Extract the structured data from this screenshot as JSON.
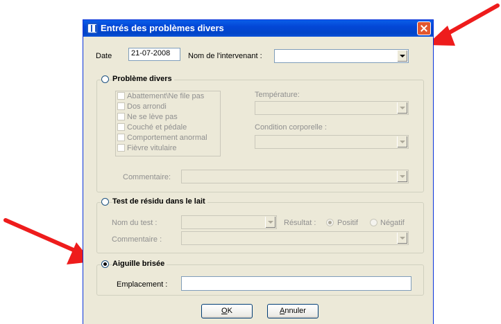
{
  "window": {
    "title": "Entrés des problèmes divers"
  },
  "header": {
    "date_label": "Date",
    "date_value": "21-07-2008",
    "intervenant_label": "Nom de l'intervenant :",
    "intervenant_value": ""
  },
  "probleme_divers": {
    "legend": "Problème divers",
    "selected": false,
    "enabled": false,
    "items": [
      {
        "label": "Abattement\\Ne file pas",
        "checked": false
      },
      {
        "label": "Dos arrondi",
        "checked": false
      },
      {
        "label": "Ne se lève pas",
        "checked": false
      },
      {
        "label": "Couché et pédale",
        "checked": false
      },
      {
        "label": "Comportement anormal",
        "checked": false
      },
      {
        "label": "Fièvre vitulaire",
        "checked": false
      }
    ],
    "temperature_label": "Température:",
    "temperature_value": "",
    "condition_label": "Condition corporelle :",
    "condition_value": "",
    "commentaire_label": "Commentaire:",
    "commentaire_value": ""
  },
  "test_residu": {
    "legend": "Test de résidu dans le lait",
    "selected": false,
    "enabled": false,
    "nom_test_label": "Nom du test :",
    "nom_test_value": "",
    "resultat_label": "Résultat :",
    "positif_label": "Positif",
    "negatif_label": "Négatif",
    "resultat_selected": "Positif",
    "commentaire_label": "Commentaire :",
    "commentaire_value": ""
  },
  "aiguille_brisee": {
    "legend": "Aiguille brisée",
    "selected": true,
    "enabled": true,
    "emplacement_label": "Emplacement :",
    "emplacement_value": ""
  },
  "buttons": {
    "ok_prefix": "O",
    "ok_rest": "K",
    "annuler_prefix": "A",
    "annuler_rest": "nnuler"
  },
  "colors": {
    "annotation_arrow": "#ee1c1c",
    "titlebar": "#0346d6",
    "dialog_bg": "#ece9d8"
  }
}
